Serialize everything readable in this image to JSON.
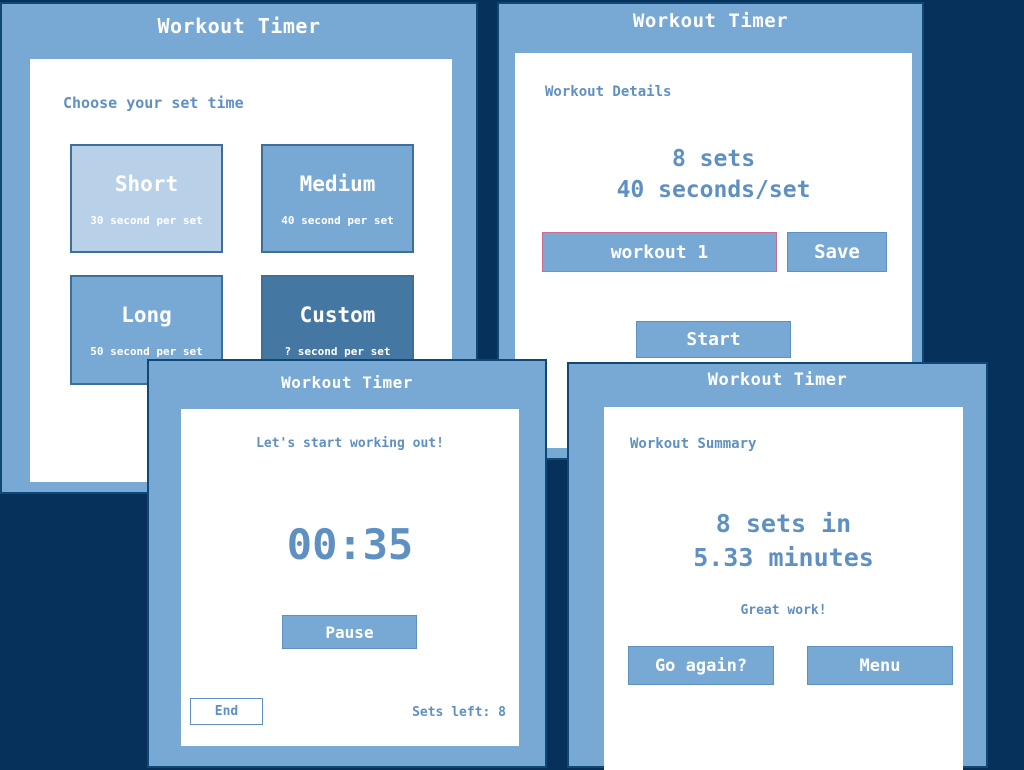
{
  "colors": {
    "background": "#05315A",
    "panel": "#78A8D4",
    "panel_border": "#0F4777",
    "text_accent": "#5F90C2",
    "tile_short": "#B8D0E8",
    "tile_medium": "#78A8D4",
    "tile_long": "#78A8D4",
    "tile_custom": "#4577A3",
    "input_border": "#D06A8E"
  },
  "screen1": {
    "title": "Workout Timer",
    "prompt": "Choose your set time",
    "tiles": [
      {
        "name": "Short",
        "sub": "30 second per set"
      },
      {
        "name": "Medium",
        "sub": "40 second per set"
      },
      {
        "name": "Long",
        "sub": "50 second per set"
      },
      {
        "name": "Custom",
        "sub": "? second per set"
      }
    ]
  },
  "screen2": {
    "title": "Workout Timer",
    "heading": "Workout Details",
    "sets_line": "8 sets",
    "time_line": "40 seconds/set",
    "name_input": "workout 1",
    "save_label": "Save",
    "start_label": "Start"
  },
  "screen3": {
    "title": "Workout Timer",
    "message": "Let's start working out!",
    "timer": "00:35",
    "pause_label": "Pause",
    "end_label": "End",
    "sets_left": "Sets left: 8"
  },
  "screen4": {
    "title": "Workout Timer",
    "heading": "Workout Summary",
    "line1": "8 sets in",
    "line2": "5.33 minutes",
    "praise": "Great work!",
    "again_label": "Go again?",
    "menu_label": "Menu"
  }
}
